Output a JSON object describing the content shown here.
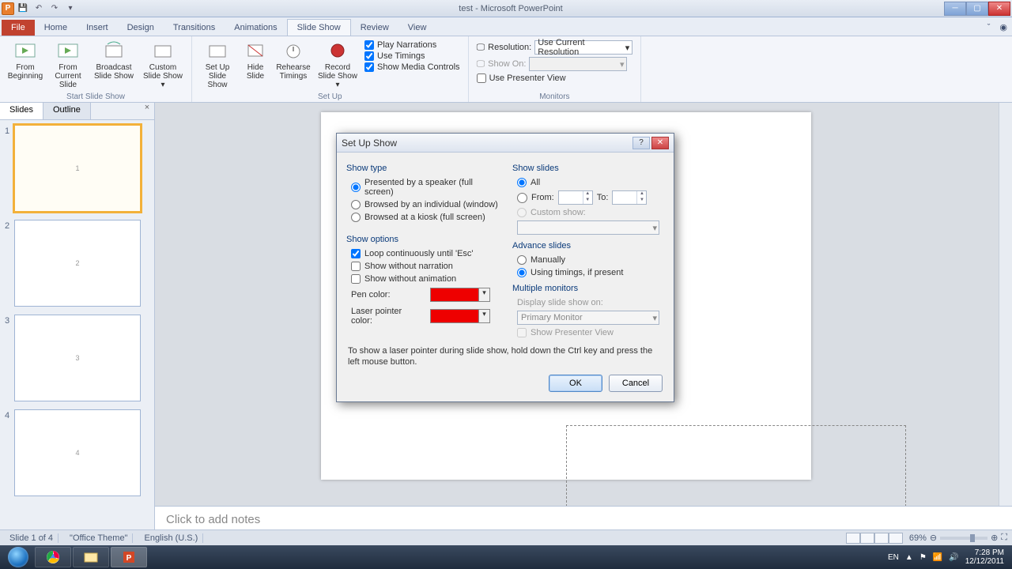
{
  "title": "test - Microsoft PowerPoint",
  "tabs": {
    "file": "File",
    "home": "Home",
    "insert": "Insert",
    "design": "Design",
    "transitions": "Transitions",
    "animations": "Animations",
    "slideshow": "Slide Show",
    "review": "Review",
    "view": "View"
  },
  "ribbon": {
    "from_beginning": "From Beginning",
    "from_current": "From Current Slide",
    "broadcast": "Broadcast Slide Show",
    "custom": "Custom Slide Show ▾",
    "group_start": "Start Slide Show",
    "setup": "Set Up Slide Show",
    "hide": "Hide Slide",
    "rehearse": "Rehearse Timings",
    "record": "Record Slide Show ▾",
    "play_narr": "Play Narrations",
    "use_timings": "Use Timings",
    "media_ctrls": "Show Media Controls",
    "group_setup": "Set Up",
    "resolution": "Resolution:",
    "res_value": "Use Current Resolution",
    "show_on": "Show On:",
    "presenter": "Use Presenter View",
    "group_monitors": "Monitors"
  },
  "slide_tabs": {
    "slides": "Slides",
    "outline": "Outline"
  },
  "thumbs": [
    "1",
    "2",
    "3",
    "4"
  ],
  "notes_placeholder": "Click to add notes",
  "status": {
    "slide": "Slide 1 of 4",
    "theme": "\"Office Theme\"",
    "lang": "English (U.S.)",
    "zoom": "69%"
  },
  "dialog": {
    "title": "Set Up Show",
    "show_type": "Show type",
    "st1": "Presented by a speaker (full screen)",
    "st2": "Browsed by an individual (window)",
    "st3": "Browsed at a kiosk (full screen)",
    "show_slides": "Show slides",
    "ss_all": "All",
    "ss_from": "From:",
    "ss_to": "To:",
    "ss_custom": "Custom show:",
    "show_options": "Show options",
    "so_loop": "Loop continuously until 'Esc'",
    "so_nonarr": "Show without narration",
    "so_noanim": "Show without animation",
    "pen": "Pen color:",
    "laser": "Laser pointer color:",
    "advance": "Advance slides",
    "adv_man": "Manually",
    "adv_tim": "Using timings, if present",
    "multimon": "Multiple monitors",
    "disp_on": "Display slide show on:",
    "primary": "Primary Monitor",
    "show_pv": "Show Presenter View",
    "hint": "To show a laser pointer during slide show, hold down the Ctrl key and press the left mouse button.",
    "ok": "OK",
    "cancel": "Cancel"
  },
  "tray": {
    "lang": "EN",
    "time": "7:28 PM",
    "date": "12/12/2011"
  }
}
